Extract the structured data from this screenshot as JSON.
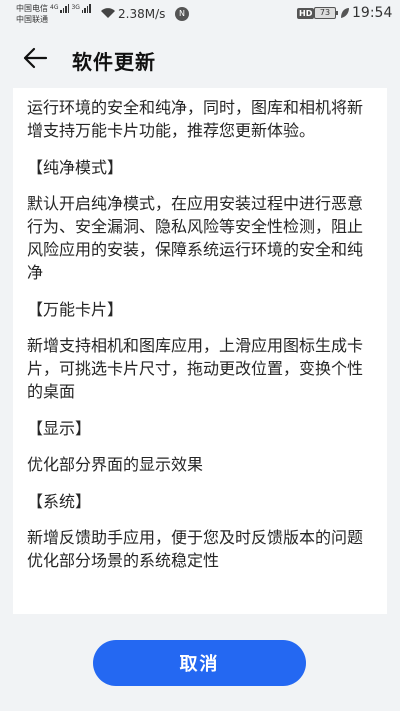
{
  "status_bar": {
    "carrier_1": "中国电信",
    "carrier_1_net": "4G",
    "carrier_2": "中国联通",
    "carrier_2_net": "3G",
    "net_speed": "2.38M/s",
    "hd_badge": "HD",
    "battery_level": "73",
    "time": "19:54",
    "icons": [
      "signal-icon",
      "wifi-icon",
      "nfc-icon",
      "battery-icon",
      "eco-leaf-icon"
    ]
  },
  "header": {
    "title": "软件更新",
    "back_icon": "arrow-left-icon"
  },
  "notes": {
    "intro_partial": "运行环境的安全和纯净，同时，图库和相机将新增支持万能卡片功能，推荐您更新体验。",
    "sections": [
      {
        "title": "【纯净模式】",
        "body": [
          "默认开启纯净模式，在应用安装过程中进行恶意行为、安全漏洞、隐私风险等安全性检测，阻止风险应用的安装，保障系统运行环境的安全和纯净"
        ]
      },
      {
        "title": "【万能卡片】",
        "body": [
          "新增支持相机和图库应用，上滑应用图标生成卡片，可挑选卡片尺寸，拖动更改位置，变换个性的桌面"
        ]
      },
      {
        "title": "【显示】",
        "body": [
          "优化部分界面的显示效果"
        ]
      },
      {
        "title": "【系统】",
        "body": [
          "新增反馈助手应用，便于您及时反馈版本的问题",
          "优化部分场景的系统稳定性"
        ]
      }
    ]
  },
  "footer": {
    "cancel_label": "取消"
  },
  "colors": {
    "background": "#f1f3f5",
    "card": "#ffffff",
    "accent": "#2468f2"
  }
}
